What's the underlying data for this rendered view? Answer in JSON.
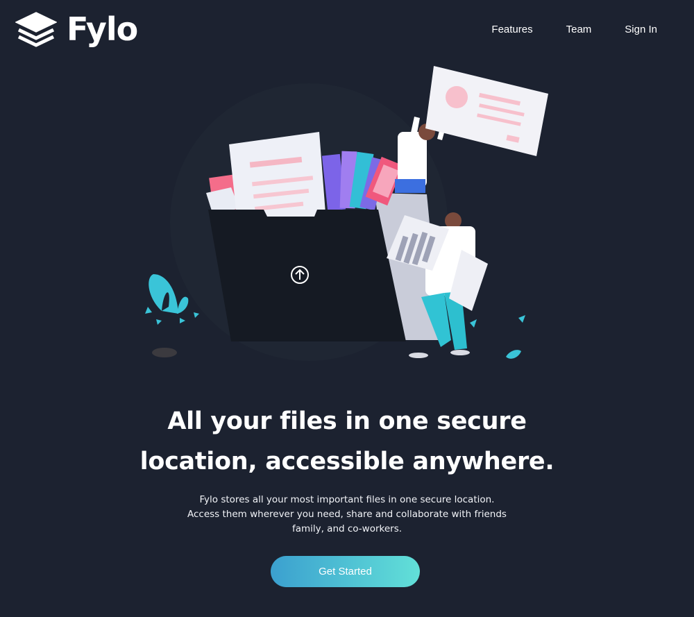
{
  "brand": {
    "name": "Fylo",
    "logo_icon": "stacked-layers-icon"
  },
  "nav": {
    "items": [
      {
        "label": "Features"
      },
      {
        "label": "Team"
      },
      {
        "label": "Sign In"
      }
    ]
  },
  "hero": {
    "illustration_icon": "upload-arrow-icon",
    "headline_line1": "All your files in one secure",
    "headline_line2": "location, accessible anywhere.",
    "subtext_line1": "Fylo stores all your most important files in one secure location.",
    "subtext_line2": "Access them wherever you need, share and collaborate with friends",
    "subtext_line3": "family, and co-workers.",
    "cta_label": "Get Started"
  },
  "colors": {
    "background": "#1c2230",
    "cta_gradient_start": "#3ba0cf",
    "cta_gradient_end": "#62e0d8",
    "text": "#ffffff"
  }
}
